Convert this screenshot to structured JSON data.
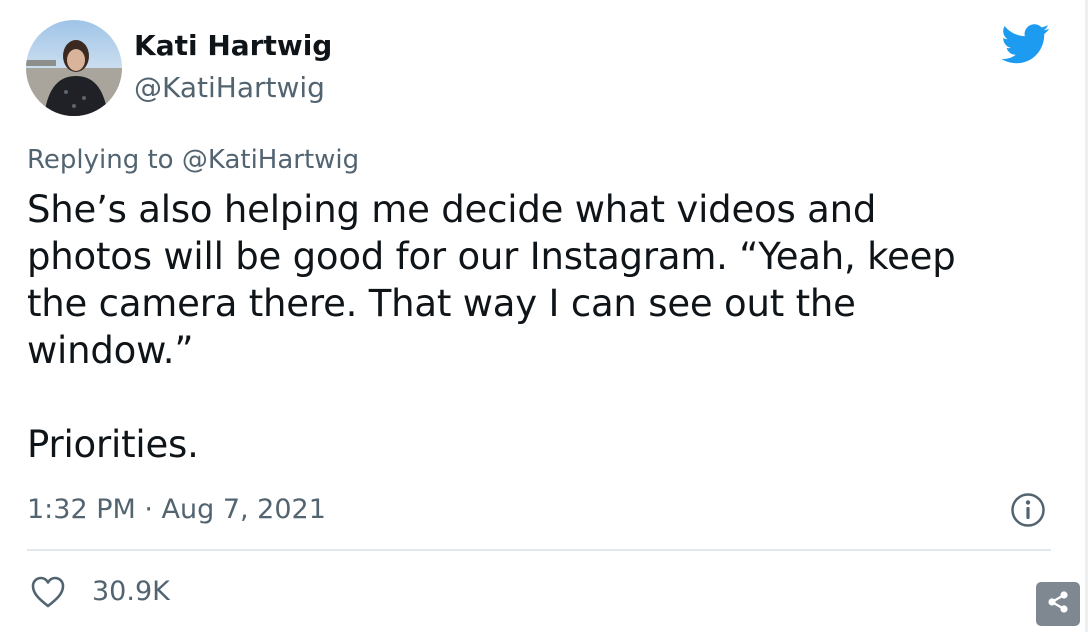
{
  "tweet": {
    "author_name": "Kati Hartwig",
    "author_handle": "@KatiHartwig",
    "reply_to": "Replying to @KatiHartwig",
    "text": "She’s also helping me decide what videos and\nphotos will be good for our Instagram. “Yeah, keep\nthe camera there. That way I can see out the\nwindow.”\n\nPriorities.",
    "timestamp": "1:32 PM · Aug 7, 2021",
    "like_count": "30.9K"
  },
  "colors": {
    "brand": "#1d9bf0",
    "text_primary": "#0f1419",
    "text_secondary": "#536471",
    "share_bg": "#7f8790"
  },
  "icons": {
    "logo": "twitter-bird-icon",
    "info": "info-icon",
    "like": "heart-icon",
    "share": "share-icon"
  }
}
